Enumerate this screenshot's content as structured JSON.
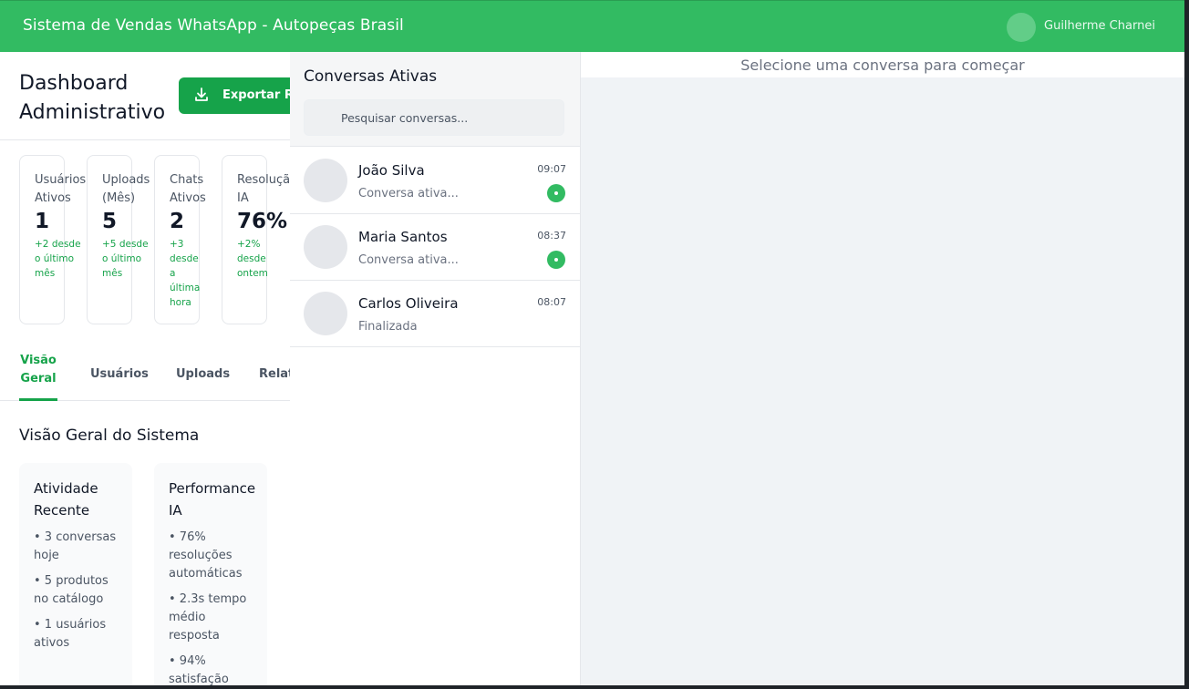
{
  "header": {
    "title": "Sistema de Vendas WhatsApp - Autopeças Brasil",
    "user_name": "Guilherme Charnei"
  },
  "dashboard": {
    "title": "Dashboard Administrativo",
    "export_label": "Exportar Re",
    "stats": [
      {
        "label": "Usuários\nAtivos",
        "value": "1",
        "change": "+2 desde\no último\nmês"
      },
      {
        "label": "Uploads\n(Mês)",
        "value": "5",
        "change": "+5 desde\no último\nmês"
      },
      {
        "label": "Chats\nAtivos",
        "value": "2",
        "change": "+3\ndesde\na\núltima\nhora"
      },
      {
        "label": "Resolução\nIA",
        "value": "76%",
        "change": "+2% desde\nontem"
      }
    ],
    "tabs": [
      {
        "label": "Visão\nGeral",
        "active": true
      },
      {
        "label": "Usuários",
        "active": false
      },
      {
        "label": "Uploads",
        "active": false
      },
      {
        "label": "Relat",
        "active": false
      }
    ],
    "section_title": "Visão Geral do Sistema",
    "cards": [
      {
        "title": "Atividade Recente",
        "items": [
          "• 3 conversas hoje",
          "• 5 produtos no catálogo",
          "• 1 usuários ativos"
        ]
      },
      {
        "title": "Performance IA",
        "items": [
          "• 76% resoluções automáticas",
          "• 2.3s tempo médio resposta",
          "• 94% satisfação"
        ]
      }
    ]
  },
  "conversations": {
    "title": "Conversas Ativas",
    "search_placeholder": "Pesquisar conversas...",
    "items": [
      {
        "name": "João Silva",
        "preview": "Conversa ativa...",
        "time": "09:07",
        "active": true
      },
      {
        "name": "Maria Santos",
        "preview": "Conversa ativa...",
        "time": "08:37",
        "active": true
      },
      {
        "name": "Carlos Oliveira",
        "preview": "Finalizada",
        "time": "08:07",
        "active": false
      }
    ]
  },
  "chat": {
    "empty_hint": "Selecione uma conversa para começar"
  },
  "colors": {
    "brand": "#32bb62",
    "accent": "#16a34a"
  }
}
